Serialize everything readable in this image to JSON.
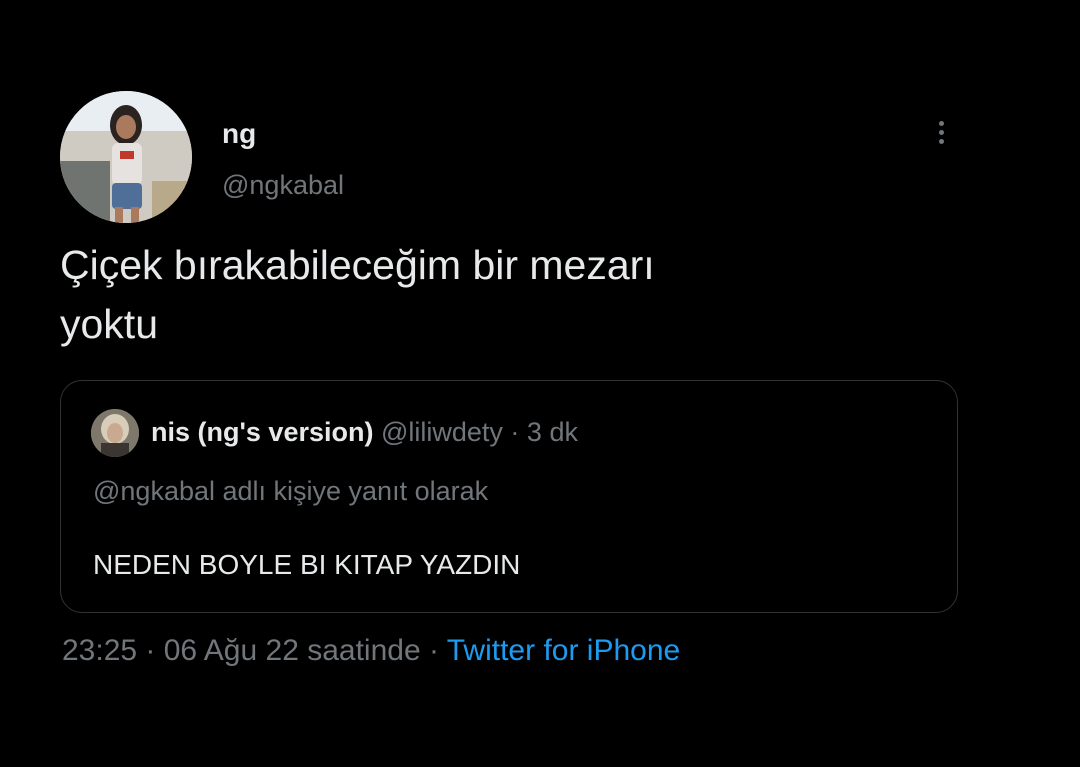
{
  "tweet": {
    "author": {
      "display_name": "ng",
      "handle": "@ngkabal",
      "avatar_icon": "user-photo-avatar"
    },
    "more_icon": "more-vertical-icon",
    "text_line1": "Çiçek bırakabileceğim bir mezarı",
    "text_line2": "yoktu",
    "quoted": {
      "avatar_icon": "user-photo-avatar",
      "display_name": "nis (ng's version)",
      "handle": "@liliwdety",
      "separator": " · ",
      "time_ago": "3 dk",
      "reply_context": "@ngkabal adlı kişiye yanıt olarak",
      "text": "NEDEN BOYLE BI KITAP YAZDIN"
    },
    "footer": {
      "time": "23:25",
      "date": "06 Ağu 22 saatinde",
      "separator": " · ",
      "source": "Twitter for iPhone"
    }
  },
  "colors": {
    "background": "#000000",
    "primary_text": "#e7e9ea",
    "secondary_text": "#71767b",
    "link": "#1d9bf0",
    "border": "#2f3336"
  }
}
